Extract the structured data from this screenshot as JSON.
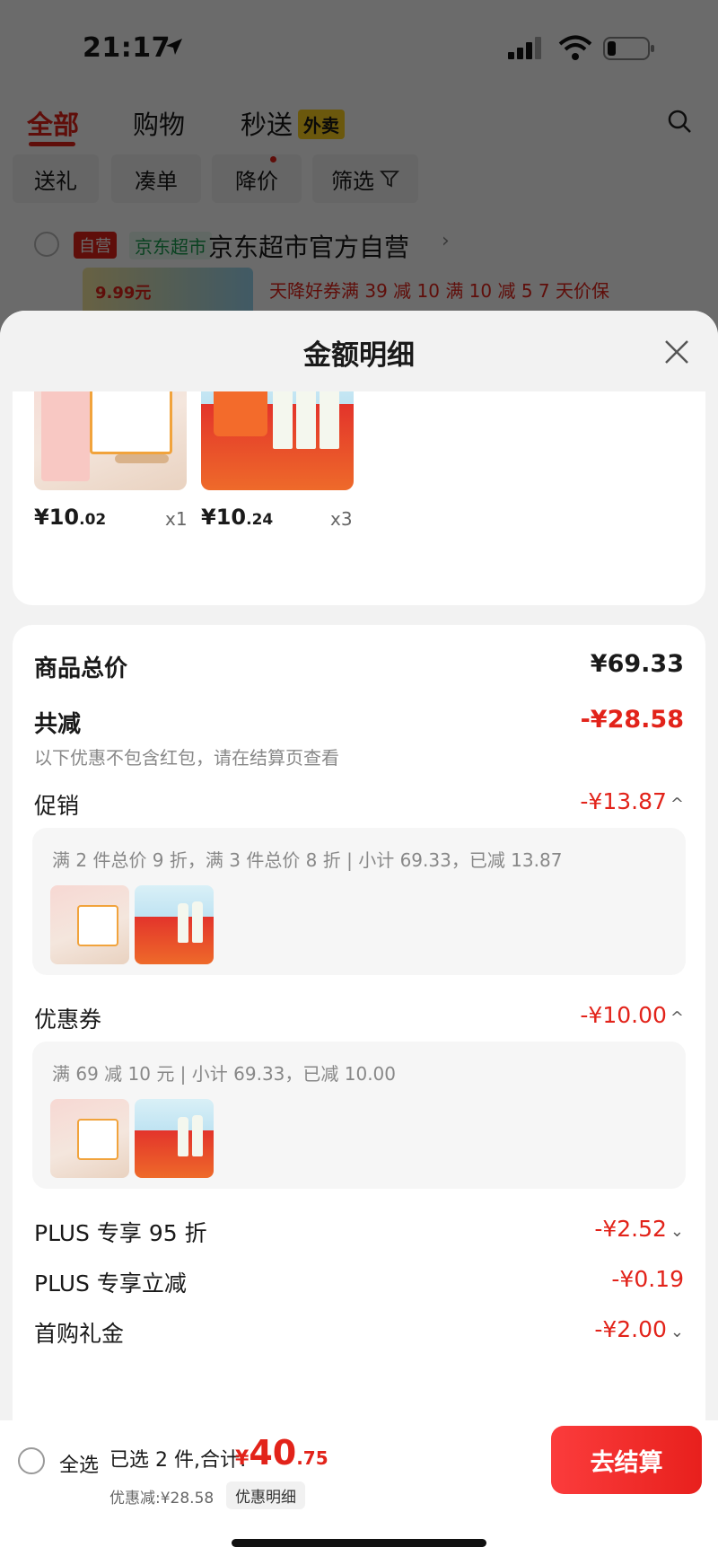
{
  "status_bar": {
    "time": "21:17"
  },
  "top_nav": {
    "tabs": [
      {
        "label": "全部",
        "active": true
      },
      {
        "label": "购物",
        "active": false
      },
      {
        "label": "秒送",
        "active": false
      }
    ],
    "miaosong_badge": "外卖"
  },
  "filter_chips": [
    "送礼",
    "凑单",
    "降价",
    "筛选"
  ],
  "store": {
    "badge": "自营",
    "channel": "京东超市",
    "name": "京东超市官方自营",
    "promo_line": "天降好券满 39 减 10   满 10 减 5   7 天价保",
    "thumb_price": "9.99元"
  },
  "sheet": {
    "title": "金额明细",
    "products": [
      {
        "price_int": "¥10",
        "price_dec": ".02",
        "qty": "x1",
        "art": "yogurt"
      },
      {
        "price_int": "¥10",
        "price_dec": ".24",
        "qty": "x3",
        "art": "milk"
      }
    ],
    "summary": {
      "total_label": "商品总价",
      "total_value": "¥69.33",
      "reduce_label": "共减",
      "reduce_value": "-¥28.58",
      "note": "以下优惠不包含红包，请在结算页查看"
    },
    "promotion": {
      "label": "促销",
      "value": "-¥13.87",
      "chevron": "^",
      "detail": "满 2 件总价 9 折，满 3 件总价 8 折 | 小计 69.33，已减 13.87"
    },
    "coupon": {
      "label": "优惠券",
      "value": "-¥10.00",
      "chevron": "^",
      "detail": "满 69 减 10 元 | 小计 69.33，已减 10.00"
    },
    "plus_95": {
      "label": "PLUS 专享 95 折",
      "value": "-¥2.52",
      "chevron": "⌄"
    },
    "plus_instant": {
      "label": "PLUS 专享立减",
      "value": "-¥0.19"
    },
    "first_buy": {
      "label": "首购礼金",
      "value": "-¥2.00",
      "chevron": "⌄"
    }
  },
  "bottom_bar": {
    "select_all": "全选",
    "selected_text": "已选 2 件,合计:",
    "total_currency": "¥",
    "total_int": "40",
    "total_dec": ".75",
    "discount_summary": "优惠减:¥28.58",
    "discount_detail_button": "优惠明细",
    "checkout_button": "去结算"
  },
  "colors": {
    "accent": "#e2231a",
    "checkout": "#f4282a",
    "jd_green": "#1a9d50"
  }
}
